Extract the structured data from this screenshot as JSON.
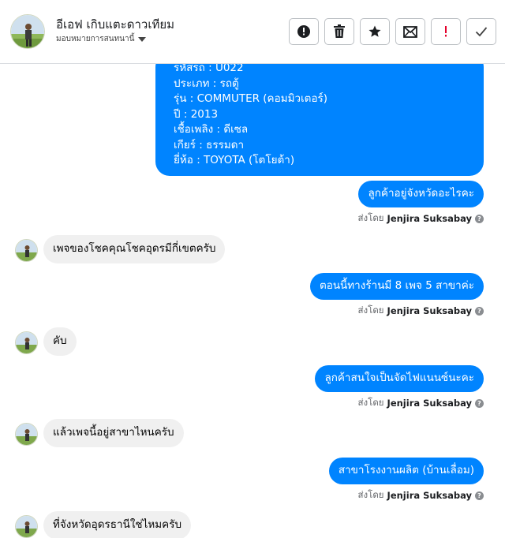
{
  "header": {
    "title": "อีเอฟ เกิบแตะดาวเทียม",
    "subtitle": "มอบหมายการสนทนานี้"
  },
  "actions": [
    {
      "name": "report-button",
      "icon": "alert-circle-icon"
    },
    {
      "name": "delete-button",
      "icon": "trash-icon"
    },
    {
      "name": "star-button",
      "icon": "star-icon"
    },
    {
      "name": "mark-unread-button",
      "icon": "envelope-icon"
    },
    {
      "name": "important-button",
      "icon": "exclamation-icon",
      "color": "#e4002b"
    },
    {
      "name": "done-button",
      "icon": "check-icon"
    }
  ],
  "colors": {
    "outgoing": "#0084ff",
    "incoming": "#f0f0f0"
  },
  "messages": {
    "car_info": [
      "รหัสรถ : U022",
      "ประเภท : รถตู้",
      "รุ่น : COMMUTER (คอมมิวเตอร์)",
      "ปี : 2013",
      "เชื้อเพลิง : ดีเซล",
      "เกียร์ : ธรรมดา",
      "ยี่ห้อ : TOYOTA (โตโยต้า)"
    ],
    "m1": "ลูกค้าอยู่จังหวัดอะไรคะ",
    "m2": "เพจของโชคคุณโชคอุดรมีกี่เขตครับ",
    "m3": "ตอนนี้ทางร้านมี 8 เพจ 5 สาขาค่ะ",
    "m4": "คับ",
    "m5": "ลูกค้าสนใจเป็นจัดไฟแนนซ์นะคะ",
    "m6": "แล้วเพจนี้อยู่สาขาไหนครับ",
    "m7": "สาขาโรงงานผลิต (บ้านเลื่อม)",
    "m8": "ที่จังหวัดอุดรธานีใช่ไหมครับ"
  },
  "sent_by": {
    "prefix": "ส่งโดย",
    "name": "Jenjira Suksabay"
  }
}
